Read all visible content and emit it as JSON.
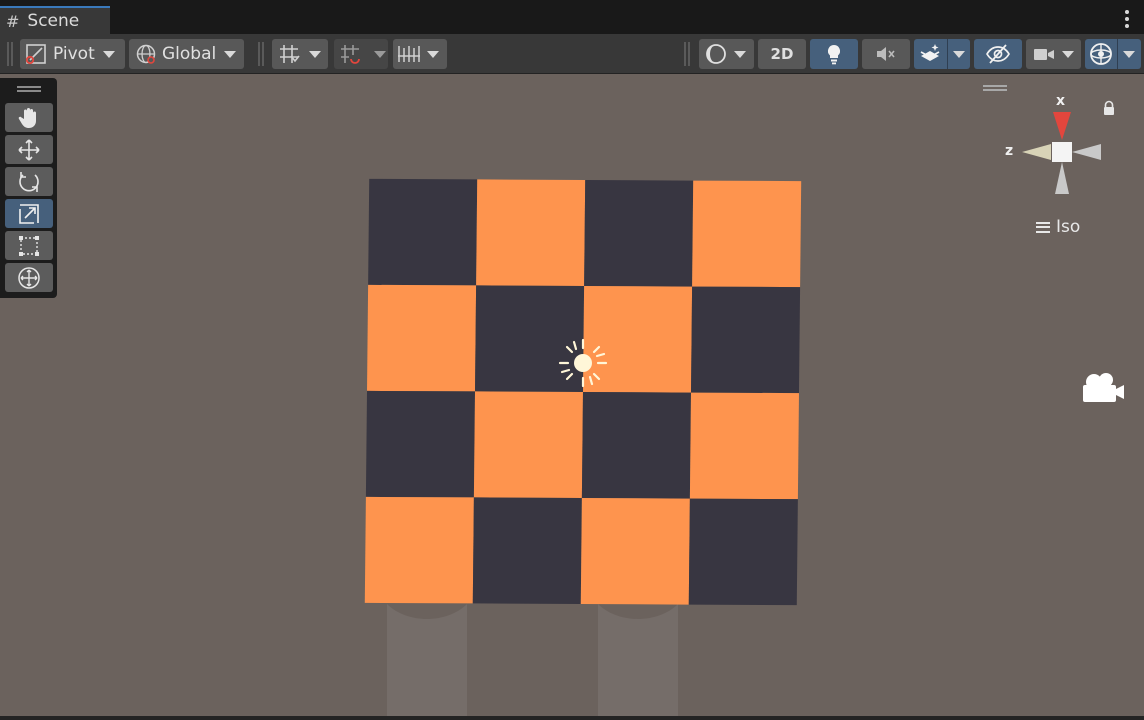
{
  "tab": {
    "icon": "hash-grid-icon",
    "title": "Scene"
  },
  "toolbar": {
    "pivot_label": "Pivot",
    "global_label": "Global",
    "mode_2d_label": "2D"
  },
  "tools": [
    {
      "name": "hand-tool",
      "icon": "hand-icon",
      "active": false
    },
    {
      "name": "move-tool",
      "icon": "move-arrows-icon",
      "active": false
    },
    {
      "name": "rotate-tool",
      "icon": "rotate-icon",
      "active": false
    },
    {
      "name": "scale-tool",
      "icon": "scale-icon",
      "active": true
    },
    {
      "name": "rect-tool",
      "icon": "rect-transform-icon",
      "active": false
    },
    {
      "name": "transform-tool",
      "icon": "transform-icon",
      "active": false
    }
  ],
  "gizmo": {
    "x_label": "x",
    "z_label": "z",
    "projection_label": "Iso"
  },
  "scene": {
    "checker_colors": {
      "orange": "#fe944e",
      "dark": "#383641"
    },
    "background": "#6b625d"
  },
  "colors": {
    "accent": "#46607c",
    "tab_underline": "#3a79bb",
    "x_axis": "#e2463d"
  }
}
